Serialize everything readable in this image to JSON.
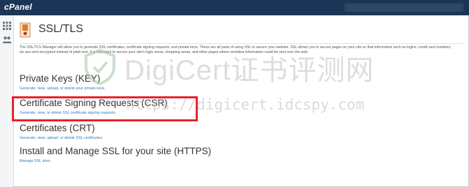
{
  "header": {
    "logo_text": "cPanel"
  },
  "sidebar": {
    "items": [
      {
        "icon": "grid-icon"
      },
      {
        "icon": "users-icon"
      }
    ]
  },
  "page": {
    "title": "SSL/TLS",
    "description": "The SSL/TLS Manager will allow you to generate SSL certificates, certificate signing requests, and private keys. These are all parts of using SSL to secure your website. SSL allows you to secure pages on your site so that information such as logins, credit card numbers, etc are sent encrypted instead of plain text. It is important to secure your site's login areas, shopping areas, and other pages where sensitive information could be sent over the web."
  },
  "sections": [
    {
      "title": "Private Keys (KEY)",
      "subtitle": "Generate, view, upload, or delete your private keys."
    },
    {
      "title": "Certificate Signing Requests (CSR)",
      "subtitle": "Generate, view, or delete SSL certificate signing requests."
    },
    {
      "title": "Certificates (CRT)",
      "subtitle": "Generate, view, upload, or delete SSL certificates."
    },
    {
      "title": "Install and Manage SSL for your site (HTTPS)",
      "subtitle": "Manage SSL sites."
    }
  ],
  "watermark": {
    "title": "DigiCert证书评测网",
    "url": "https://digicert.idcspy.com"
  },
  "colors": {
    "topbar": "#1a3555",
    "link": "#2e7bb6",
    "highlight": "#e8202a"
  }
}
